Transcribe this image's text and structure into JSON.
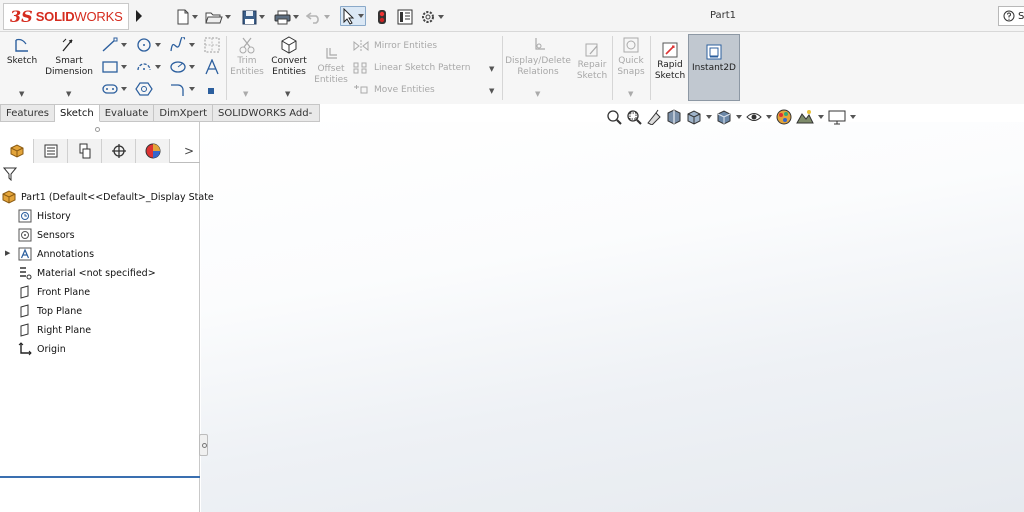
{
  "app": {
    "logo_prefix": "3S",
    "logo_solid": "SOLID",
    "logo_works": "WORKS",
    "document_title": "Part1",
    "help_label": "S"
  },
  "colors": {
    "brand_red": "#d52b1e",
    "selection_blue": "#3a6fb0",
    "instant2d_bg": "#c1c8d0"
  },
  "quick_access": {
    "icons": [
      "new-document-icon",
      "open-folder-icon",
      "save-icon",
      "print-icon",
      "undo-icon",
      "select-arrow-icon",
      "rebuild-icon",
      "file-properties-icon",
      "options-gear-icon"
    ]
  },
  "ribbon": {
    "sketch_label": "Sketch",
    "smart_dimension_label": "Smart\nDimension",
    "trim_entities_label": "Trim\nEntities",
    "convert_entities_label": "Convert\nEntities",
    "offset_entities_label": "Offset\nEntities",
    "mirror_entities_label": "Mirror Entities",
    "linear_sketch_pattern_label": "Linear Sketch Pattern",
    "move_entities_label": "Move Entities",
    "display_delete_relations_label": "Display/Delete\nRelations",
    "repair_sketch_label": "Repair\nSketch",
    "quick_snaps_label": "Quick\nSnaps",
    "rapid_sketch_label": "Rapid\nSketch",
    "instant2d_label": "Instant2D"
  },
  "tabs": [
    {
      "label": "Features",
      "active": false
    },
    {
      "label": "Sketch",
      "active": true
    },
    {
      "label": "Evaluate",
      "active": false
    },
    {
      "label": "DimXpert",
      "active": false
    },
    {
      "label": "SOLIDWORKS Add-Ins",
      "active": false
    }
  ],
  "panel": {
    "more_glyph": ">",
    "tree": {
      "root": "Part1  (Default<<Default>_Display State",
      "items": [
        "History",
        "Sensors",
        "Annotations",
        "Material <not specified>",
        "Front Plane",
        "Top Plane",
        "Right Plane",
        "Origin"
      ]
    }
  }
}
